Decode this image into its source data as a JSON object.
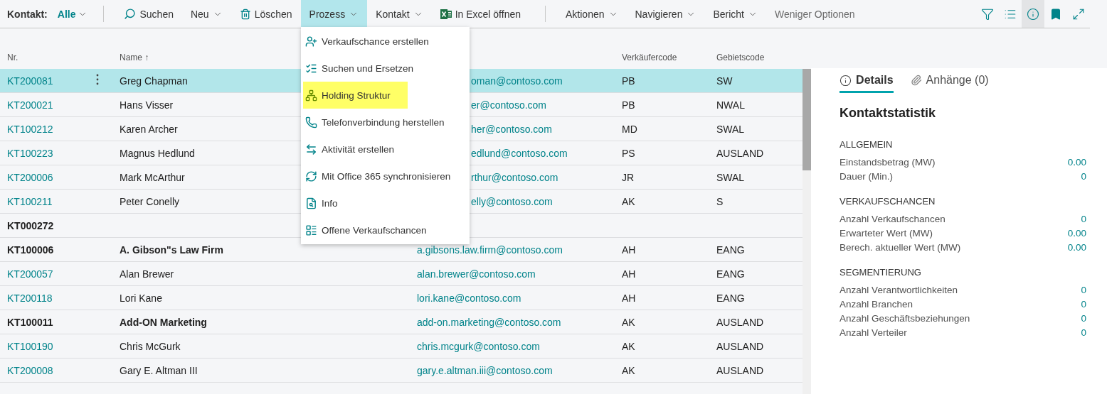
{
  "filter": {
    "label": "Kontakt:",
    "value": "Alle"
  },
  "toolbar_groups": [
    [
      {
        "label": "Suchen",
        "kind": "search",
        "expanded": false
      },
      {
        "label": "Neu",
        "kind": "menu",
        "expanded": false
      },
      {
        "label": "Löschen",
        "kind": "delete",
        "expanded": false
      },
      {
        "label": "Prozess",
        "kind": "menu",
        "expanded": true
      },
      {
        "label": "Kontakt",
        "kind": "menu",
        "expanded": false
      },
      {
        "label": "In Excel öffnen",
        "kind": "excel",
        "expanded": false
      }
    ],
    [
      {
        "label": "Aktionen",
        "kind": "menu",
        "expanded": false
      },
      {
        "label": "Navigieren",
        "kind": "menu",
        "expanded": false
      },
      {
        "label": "Bericht",
        "kind": "menu",
        "expanded": false
      },
      {
        "label": "Weniger Optionen",
        "kind": "link",
        "expanded": false
      }
    ]
  ],
  "view_buttons": [
    {
      "selected": false
    },
    {
      "selected": false
    },
    {
      "selected": true
    },
    {
      "selected": false
    },
    {
      "selected": false
    }
  ],
  "process_menu": [
    {
      "label": "Verkaufschance erstellen",
      "selected": false
    },
    {
      "label": "Suchen und Ersetzen",
      "selected": false
    },
    {
      "label": "Holding Struktur",
      "selected": true
    },
    {
      "label": "Telefonverbindung herstellen",
      "selected": false
    },
    {
      "label": "Aktivität erstellen",
      "selected": false
    },
    {
      "label": "Mit Office 365 synchronisieren",
      "selected": false
    },
    {
      "label": "Info",
      "selected": false
    },
    {
      "label": "Offene Verkaufschancen",
      "selected": false
    }
  ],
  "table": {
    "columns": [
      "Nr.",
      "Name ↑",
      "Verkäufercode",
      "Gebietscode"
    ],
    "rows": [
      {
        "kind": "person",
        "selected": true,
        "no": "KT200081",
        "name": "Greg Chapman",
        "email": "oman@contoso.com",
        "email_cut": true,
        "salesperson": "PB",
        "territory": "SW"
      },
      {
        "kind": "person",
        "selected": false,
        "no": "KT200021",
        "name": "Hans Visser",
        "email": "er@contoso.com",
        "email_cut": true,
        "salesperson": "PB",
        "territory": "NWAL"
      },
      {
        "kind": "person",
        "selected": false,
        "no": "KT100212",
        "name": "Karen Archer",
        "email": "her@contoso.com",
        "email_cut": true,
        "salesperson": "MD",
        "territory": "SWAL"
      },
      {
        "kind": "person",
        "selected": false,
        "no": "KT100223",
        "name": "Magnus Hedlund",
        "email": "edlund@contoso.com",
        "email_cut": true,
        "salesperson": "PS",
        "territory": "AUSLAND"
      },
      {
        "kind": "person",
        "selected": false,
        "no": "KT200006",
        "name": "Mark McArthur",
        "email": "rthur@contoso.com",
        "email_cut": true,
        "salesperson": "JR",
        "territory": "SWAL"
      },
      {
        "kind": "person",
        "selected": false,
        "no": "KT100211",
        "name": "Peter Conelly",
        "email": "elly@contoso.com",
        "email_cut": true,
        "salesperson": "AK",
        "territory": "S"
      },
      {
        "kind": "company",
        "selected": false,
        "no": "KT000272"
      },
      {
        "kind": "company",
        "selected": false,
        "no": "KT100006",
        "name": "A. Gibson\"s Law Firm",
        "email": "a.gibsons.law.firm@contoso.com",
        "email_cut": false,
        "salesperson": "AH",
        "territory": "EANG"
      },
      {
        "kind": "person",
        "selected": false,
        "no": "KT200057",
        "name": "Alan Brewer",
        "email": "alan.brewer@contoso.com",
        "email_cut": false,
        "salesperson": "AH",
        "territory": "EANG"
      },
      {
        "kind": "person",
        "selected": false,
        "no": "KT200118",
        "name": "Lori Kane",
        "email": "lori.kane@contoso.com",
        "email_cut": false,
        "salesperson": "AH",
        "territory": "EANG"
      },
      {
        "kind": "company",
        "selected": false,
        "no": "KT100011",
        "name": "Add-ON Marketing",
        "email": "add-on.marketing@contoso.com",
        "email_cut": false,
        "salesperson": "AK",
        "territory": "AUSLAND"
      },
      {
        "kind": "person",
        "selected": false,
        "no": "KT100190",
        "name": "Chris McGurk",
        "email": "chris.mcgurk@contoso.com",
        "email_cut": false,
        "salesperson": "AK",
        "territory": "AUSLAND"
      },
      {
        "kind": "person",
        "selected": false,
        "no": "KT200008",
        "name": "Gary E. Altman III",
        "email": "gary.e.altman.iii@contoso.com",
        "email_cut": false,
        "salesperson": "AK",
        "territory": "AUSLAND"
      }
    ]
  },
  "factbox": {
    "tabs": [
      {
        "label": "Details",
        "kind": "info",
        "selected": true
      },
      {
        "label": "Anhänge (0)",
        "kind": "attachment",
        "selected": false
      }
    ],
    "title": "Kontaktstatistik",
    "sections": [
      {
        "heading": "ALLGEMEIN",
        "rows": [
          {
            "label": "Einstandsbetrag (MW)",
            "value": "0.00"
          },
          {
            "label": "Dauer (Min.)",
            "value": "0"
          }
        ]
      },
      {
        "heading": "VERKAUFSCHANCEN",
        "rows": [
          {
            "label": "Anzahl Verkaufschancen",
            "value": "0"
          },
          {
            "label": "Erwarteter Wert (MW)",
            "value": "0.00"
          },
          {
            "label": "Berech. aktueller Wert (MW)",
            "value": "0.00"
          }
        ]
      },
      {
        "heading": "SEGMENTIERUNG",
        "rows": [
          {
            "label": "Anzahl Verantwortlichkeiten",
            "value": "0"
          },
          {
            "label": "Anzahl Branchen",
            "value": "0"
          },
          {
            "label": "Anzahl Geschäftsbeziehungen",
            "value": "0"
          },
          {
            "label": "Anzahl Verteiler",
            "value": "0"
          }
        ]
      }
    ]
  }
}
